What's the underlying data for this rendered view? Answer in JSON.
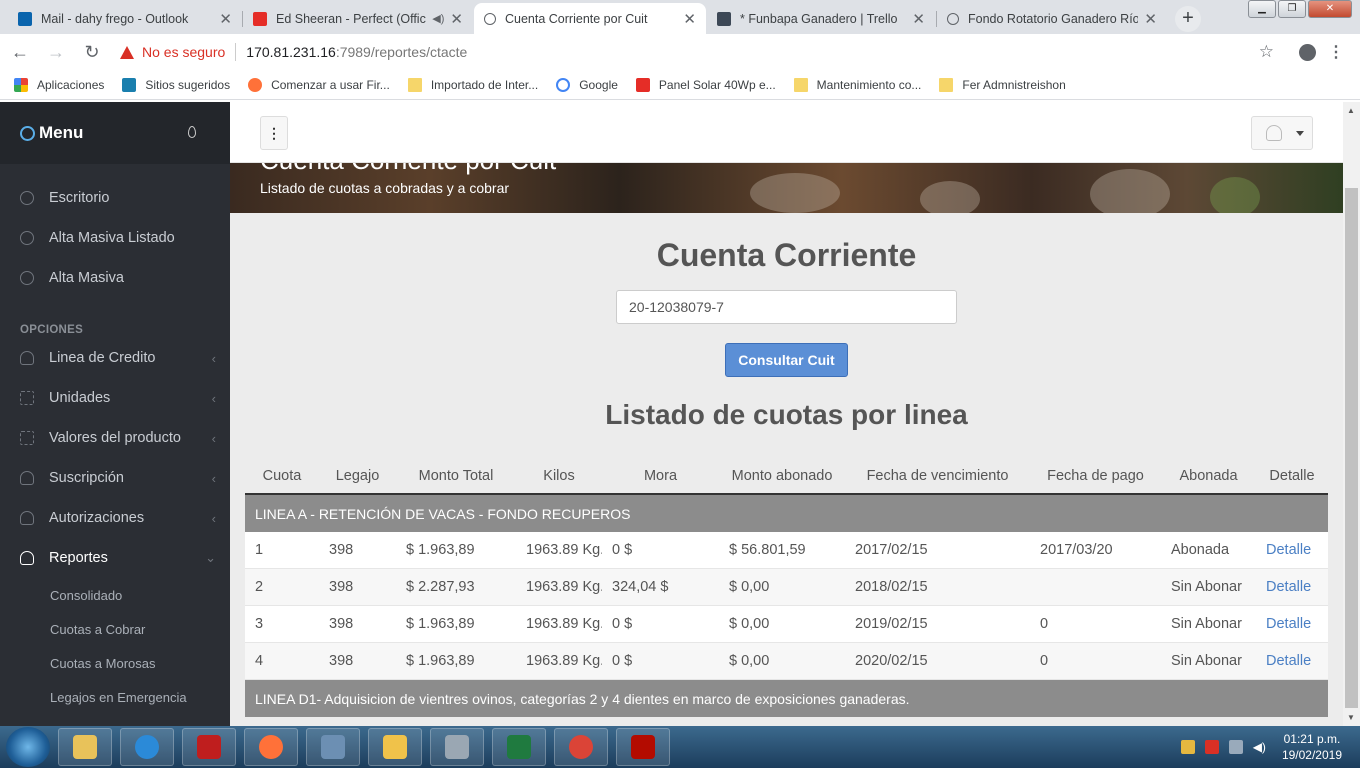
{
  "browser": {
    "tabs": [
      {
        "title": "Mail - dahy frego - Outlook",
        "icon": "outlook-icon",
        "color": "#0a64ad"
      },
      {
        "title": "Ed Sheeran - Perfect (Offici",
        "icon": "youtube-icon",
        "color": "#e52d27"
      },
      {
        "title": "Cuenta Corriente por Cuit",
        "icon": "loading-icon",
        "color": "#5f6368"
      },
      {
        "title": "* Funbapa Ganadero | Trello",
        "icon": "trello-icon",
        "color": "#3d4856"
      },
      {
        "title": "Fondo Rotatorio Ganadero Río",
        "icon": "loading-icon",
        "color": "#5f6368"
      }
    ],
    "new_tab": "+",
    "security_label": "No es seguro",
    "url_host": "170.81.231.16",
    "url_rest": ":7989/reportes/ctacte",
    "bookmarks": [
      {
        "label": "Aplicaciones",
        "icon": "apps-icon",
        "color": "#ea4335"
      },
      {
        "label": "Sitios sugeridos",
        "icon": "bing-icon",
        "color": "#1a7fae"
      },
      {
        "label": "Comenzar a usar Fir...",
        "icon": "firefox-icon",
        "color": "#ff7139"
      },
      {
        "label": "Importado de Inter...",
        "icon": "folder-icon",
        "color": "#f6d66a"
      },
      {
        "label": "Google",
        "icon": "google-icon",
        "color": "#4285f4"
      },
      {
        "label": "Panel Solar 40Wp e...",
        "icon": "youtube-icon",
        "color": "#e52d27"
      },
      {
        "label": "Mantenimiento co...",
        "icon": "folder-icon",
        "color": "#f6d66a"
      },
      {
        "label": "Fer Admnistreishon",
        "icon": "folder-icon",
        "color": "#f6d66a"
      }
    ]
  },
  "sidebar": {
    "title": "Menu",
    "items": [
      {
        "label": "Escritorio"
      },
      {
        "label": "Alta Masiva Listado"
      },
      {
        "label": "Alta Masiva"
      }
    ],
    "section": "OPCIONES",
    "options": [
      {
        "label": "Linea de Credito",
        "icon": "user"
      },
      {
        "label": "Unidades",
        "icon": "grid"
      },
      {
        "label": "Valores del producto",
        "icon": "grid"
      },
      {
        "label": "Suscripción",
        "icon": "user"
      },
      {
        "label": "Autorizaciones",
        "icon": "user"
      }
    ],
    "reportes": {
      "label": "Reportes"
    },
    "subitems": [
      {
        "label": "Consolidado"
      },
      {
        "label": "Cuotas a Cobrar"
      },
      {
        "label": "Cuotas a Morosas"
      },
      {
        "label": "Legajos en Emergencia"
      }
    ]
  },
  "banner": {
    "title": "Cuenta Corriente por Cuit",
    "subtitle": "Listado de cuotas a cobradas y a cobrar"
  },
  "main": {
    "heading": "Cuenta Corriente",
    "cuit_value": "20-12038079-7",
    "button_label": "Consultar Cuit",
    "list_heading": "Listado de cuotas por linea",
    "columns": [
      "Cuota",
      "Legajo",
      "Monto Total",
      "Kilos",
      "Mora",
      "Monto abonado",
      "Fecha de vencimiento",
      "Fecha de pago",
      "Abonada",
      "Detalle"
    ],
    "group1": "LINEA A - RETENCIÓN DE VACAS - FONDO RECUPEROS",
    "rows": [
      [
        "1",
        "398",
        "$ 1.963,89",
        "1963.89 Kg.",
        "0 $",
        "$ 56.801,59",
        "2017/02/15",
        "2017/03/20",
        "Abonada",
        "Detalle"
      ],
      [
        "2",
        "398",
        "$ 2.287,93",
        "1963.89 Kg.",
        "324,04 $",
        "$ 0,00",
        "2018/02/15",
        "",
        "Sin Abonar",
        "Detalle"
      ],
      [
        "3",
        "398",
        "$ 1.963,89",
        "1963.89 Kg.",
        "0 $",
        "$ 0,00",
        "2019/02/15",
        "0",
        "Sin Abonar",
        "Detalle"
      ],
      [
        "4",
        "398",
        "$ 1.963,89",
        "1963.89 Kg.",
        "0 $",
        "$ 0,00",
        "2020/02/15",
        "0",
        "Sin Abonar",
        "Detalle"
      ]
    ],
    "group2": "LINEA D1- Adquisicion de vientres ovinos, categorías 2 y 4 dientes en marco de exposiciones ganaderas."
  },
  "taskbar": {
    "apps": [
      {
        "name": "explorer-icon",
        "color": "#e8c25a"
      },
      {
        "name": "ie-icon",
        "color": "#2b8ad8"
      },
      {
        "name": "filezilla-icon",
        "color": "#bf1e1e"
      },
      {
        "name": "firefox-icon",
        "color": "#ff7139"
      },
      {
        "name": "network-icon",
        "color": "#6c8fb3"
      },
      {
        "name": "outlook-icon",
        "color": "#f0c24a"
      },
      {
        "name": "calculator-icon",
        "color": "#9aa7b3"
      },
      {
        "name": "excel-icon",
        "color": "#1f7a3f"
      },
      {
        "name": "chrome-icon",
        "color": "#db4437"
      },
      {
        "name": "acrobat-icon",
        "color": "#b30b00"
      }
    ],
    "time": "01:21 p.m.",
    "date": "19/02/2019"
  }
}
